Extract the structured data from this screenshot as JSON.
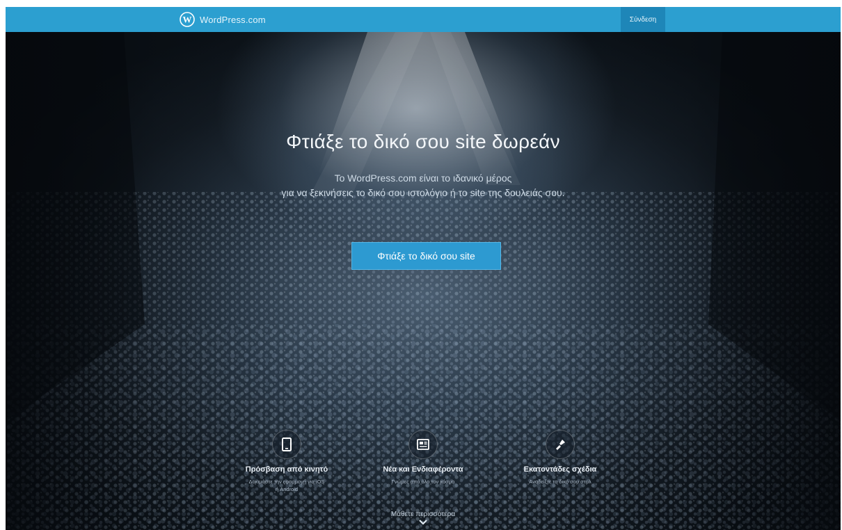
{
  "header": {
    "logo_text": "WordPress.com",
    "signin_label": "Σύνδεση",
    "bar_color": "#2c9fd0",
    "signin_color": "#1e86b8"
  },
  "hero": {
    "title": "Φτιάξε το δικό σου site δωρεάν",
    "subtitle_line1": "Το WordPress.com είναι το ιδανικό μέρος",
    "subtitle_line2": "για να ξεκινήσεις το δικό σου ιστολόγιο ή το site της δουλειάς σου.",
    "cta_label": "Φτιάξε το δικό σου site",
    "cta_color": "#2d9ad1"
  },
  "features": [
    {
      "icon": "mobile-icon",
      "title": "Πρόσβαση από κινητό",
      "desc_line1": "Δοκιμάστε την εφαρμογή για iOS",
      "desc_line2": "ή Android"
    },
    {
      "icon": "news-icon",
      "title": "Νέα και Ενδιαφέροντα",
      "desc_line1": "Γνώμες από όλο τον κόσμο",
      "desc_line2": ""
    },
    {
      "icon": "brush-icon",
      "title": "Εκατοντάδες σχέδια",
      "desc_line1": "Αναδείξτε το δικό σου στυλ",
      "desc_line2": ""
    }
  ],
  "footer": {
    "learn_more": "Μάθετε περισσότερα"
  }
}
